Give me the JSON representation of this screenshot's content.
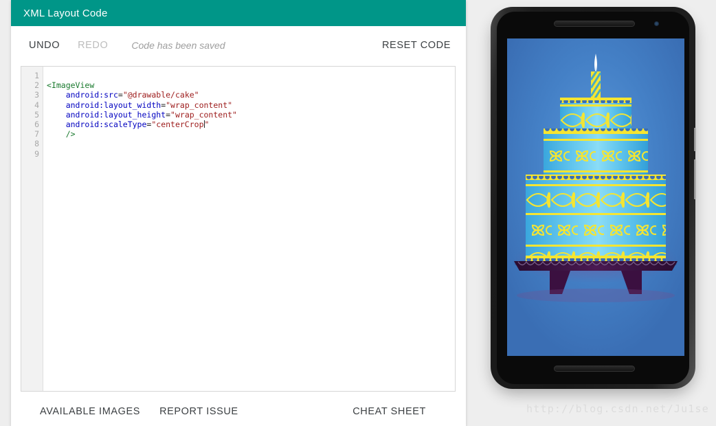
{
  "page": {
    "background_color": "#eeeeee"
  },
  "card": {
    "header": {
      "title": "XML Layout Code",
      "background_color": "#009688",
      "text_color": "#ffffff"
    },
    "toolbar_top": {
      "undo_label": "UNDO",
      "redo_label": "REDO",
      "status_text": "Code has been saved",
      "reset_label": "RESET CODE"
    },
    "toolbar_bottom": {
      "available_images_label": "AVAILABLE IMAGES",
      "report_issue_label": "REPORT ISSUE",
      "cheat_sheet_label": "CHEAT SHEET"
    },
    "editor": {
      "line_numbers": [
        "1",
        "2",
        "3",
        "4",
        "5",
        "6",
        "7",
        "8",
        "9"
      ],
      "lines": [
        {
          "indent": "",
          "segments": []
        },
        {
          "indent": "",
          "segments": [
            {
              "text": "<",
              "type": "bracket"
            },
            {
              "text": "ImageView",
              "type": "tag"
            }
          ]
        },
        {
          "indent": "    ",
          "segments": [
            {
              "text": "android:src",
              "type": "attr"
            },
            {
              "text": "=",
              "type": "eq"
            },
            {
              "text": "\"@drawable/cake\"",
              "type": "val"
            }
          ]
        },
        {
          "indent": "    ",
          "segments": [
            {
              "text": "android:layout_width",
              "type": "attr"
            },
            {
              "text": "=",
              "type": "eq"
            },
            {
              "text": "\"wrap_content\"",
              "type": "val"
            }
          ]
        },
        {
          "indent": "    ",
          "segments": [
            {
              "text": "android:layout_height",
              "type": "attr"
            },
            {
              "text": "=",
              "type": "eq"
            },
            {
              "text": "\"wrap_content\"",
              "type": "val"
            }
          ]
        },
        {
          "indent": "    ",
          "segments": [
            {
              "text": "android:scaleType",
              "type": "attr"
            },
            {
              "text": "=",
              "type": "eq"
            },
            {
              "text": "\"centerCrop",
              "type": "val"
            },
            {
              "text": "CARET",
              "type": "caret"
            },
            {
              "text": "\"",
              "type": "val"
            }
          ]
        },
        {
          "indent": "    ",
          "segments": [
            {
              "text": "/>",
              "type": "bracket"
            }
          ]
        },
        {
          "indent": "",
          "segments": []
        },
        {
          "indent": "",
          "segments": []
        }
      ],
      "colors": {
        "tag": "#1a7a2e",
        "attribute": "#0000c0",
        "value": "#9c1a1a",
        "gutter_text": "#a8a8a8",
        "gutter_background": "#f2f2f2"
      }
    }
  },
  "preview": {
    "device_name": "phone-mockup",
    "wallpaper": {
      "name": "cake",
      "background_top_color": "#3f76bf",
      "background_glow_color": "#5a93d6",
      "cake_body_color": "#41b6e6",
      "cake_highlight_color": "#7fd4f2",
      "decoration_color": "#f5e531",
      "stand_color": "#3b1040",
      "candle_color": "#f5e531",
      "flame_color": "#ffffff",
      "tiers": 3
    }
  },
  "watermark": {
    "text": "http://blog.csdn.net/Ju1se",
    "color": "#dcdcdc"
  }
}
